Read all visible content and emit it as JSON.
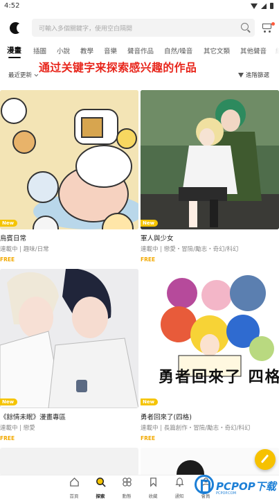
{
  "status": {
    "time": "4:52"
  },
  "search": {
    "placeholder": "可輸入多個關鍵字，使用空白隔開"
  },
  "tabs": [
    "漫畫",
    "插圖",
    "小說",
    "教學",
    "音樂",
    "聲音作品",
    "自然/噪音",
    "其它文類",
    "其他聲音",
    "網"
  ],
  "sort": {
    "label": "最近更新",
    "filter_label": "進階篩選"
  },
  "banner": "通过关键字来探索感兴趣的作品",
  "works": [
    {
      "title": "烏賓日常",
      "tags": "連載中 | 趣味/日常",
      "price": "FREE",
      "new": "New"
    },
    {
      "title": "軍人與少女",
      "tags": "連載中 | 戀愛・冒險/勵志・奇幻/科幻",
      "price": "FREE",
      "new": "New"
    },
    {
      "title": "《餘情未眠》漫畫專區",
      "tags": "連載中 | 戀愛",
      "price": "FREE",
      "new": "New"
    },
    {
      "title": "勇者回來了(四格)",
      "tags": "連載中 | 長篇創作・冒險/勵志・奇幻/科幻",
      "price": "FREE",
      "new": "New",
      "cover_text": "勇者回來了 四格漫畫"
    }
  ],
  "nav": [
    {
      "label": "首頁",
      "icon": "home-icon"
    },
    {
      "label": "探索",
      "icon": "explore-icon"
    },
    {
      "label": "動態",
      "icon": "feed-icon"
    },
    {
      "label": "收藏",
      "icon": "bookmark-icon"
    },
    {
      "label": "通知",
      "icon": "bell-icon"
    },
    {
      "label": "會員",
      "icon": "member-icon"
    }
  ],
  "watermark": {
    "text": "PCPOP下载",
    "sub": "PCPOP.COM"
  },
  "colors": {
    "banner": "#e8271d",
    "accent": "#f5c400",
    "free": "#f2a900",
    "watermark": "#1c7fd6"
  }
}
